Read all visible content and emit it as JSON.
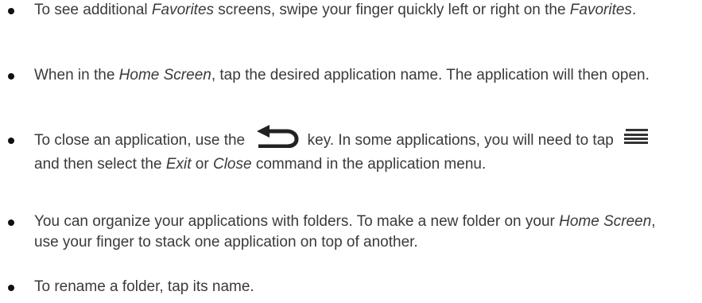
{
  "bullets": [
    {
      "t1": "To see additional ",
      "em1": "Favorites",
      "t2": " screens, swipe your finger quickly left or right on the ",
      "em2": "Favorites",
      "t3": "."
    },
    {
      "t1": "When in the ",
      "em1": "Home Screen",
      "t2": ", tap the desired application name. The application will then open."
    },
    {
      "t1": "To close an application, use the ",
      "icon1": "back-arrow-icon",
      "t2": " key. In some applications, you will need to tap ",
      "icon2": "menu-icon",
      "t3": " and then select the ",
      "em1": "Exit",
      "t4": " or ",
      "em2": "Close",
      "t5": " command in the application menu."
    },
    {
      "t1": "You can organize your applications with folders. To make a new folder on your ",
      "em1": "Home Screen",
      "t2": ", use your finger to stack one application on top of another."
    },
    {
      "t1": "To rename a folder, tap its name."
    }
  ]
}
